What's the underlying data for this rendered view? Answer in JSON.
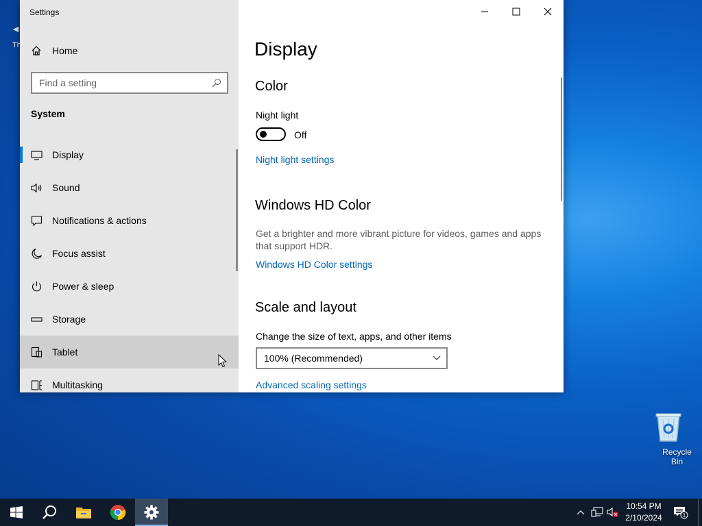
{
  "desktop": {
    "left_icon_glyph": "◄",
    "left_icon_text": "Th",
    "recycle_bin_label": "Recycle Bin"
  },
  "window": {
    "title": "Settings",
    "controls": [
      "minimize-icon",
      "maximize-icon",
      "close-icon"
    ]
  },
  "sidebar": {
    "home_label": "Home",
    "search_placeholder": "Find a setting",
    "section_label": "System",
    "items": [
      {
        "label": "Display",
        "icon": "monitor-icon",
        "active": true
      },
      {
        "label": "Sound",
        "icon": "speaker-icon"
      },
      {
        "label": "Notifications & actions",
        "icon": "notification-icon"
      },
      {
        "label": "Focus assist",
        "icon": "moon-icon"
      },
      {
        "label": "Power & sleep",
        "icon": "power-icon"
      },
      {
        "label": "Storage",
        "icon": "storage-icon"
      },
      {
        "label": "Tablet",
        "icon": "tablet-icon",
        "hover": true
      },
      {
        "label": "Multitasking",
        "icon": "multitasking-icon"
      }
    ]
  },
  "content": {
    "page_title": "Display",
    "color_heading": "Color",
    "night_light_label": "Night light",
    "night_light_state": "Off",
    "night_light_link": "Night light settings",
    "hd_heading": "Windows HD Color",
    "hd_description": "Get a brighter and more vibrant picture for videos, games and apps that support HDR.",
    "hd_link": "Windows HD Color settings",
    "scale_heading": "Scale and layout",
    "scale_label": "Change the size of text, apps, and other items",
    "scale_value": "100% (Recommended)",
    "scale_link": "Advanced scaling settings"
  },
  "taskbar": {
    "apps": [
      "windows-start-icon",
      "search-icon",
      "file-explorer-icon",
      "chrome-icon",
      "settings-gear-icon"
    ],
    "active_app": "settings-gear-icon",
    "clock_time": "10:54 PM",
    "clock_date": "2/10/2024",
    "notification_count": "1"
  },
  "colors": {
    "accent": "#0078d4",
    "link": "#0067b8",
    "sidebar_bg": "#e6e6e6",
    "taskbar_bg": "#0f1b2a"
  }
}
